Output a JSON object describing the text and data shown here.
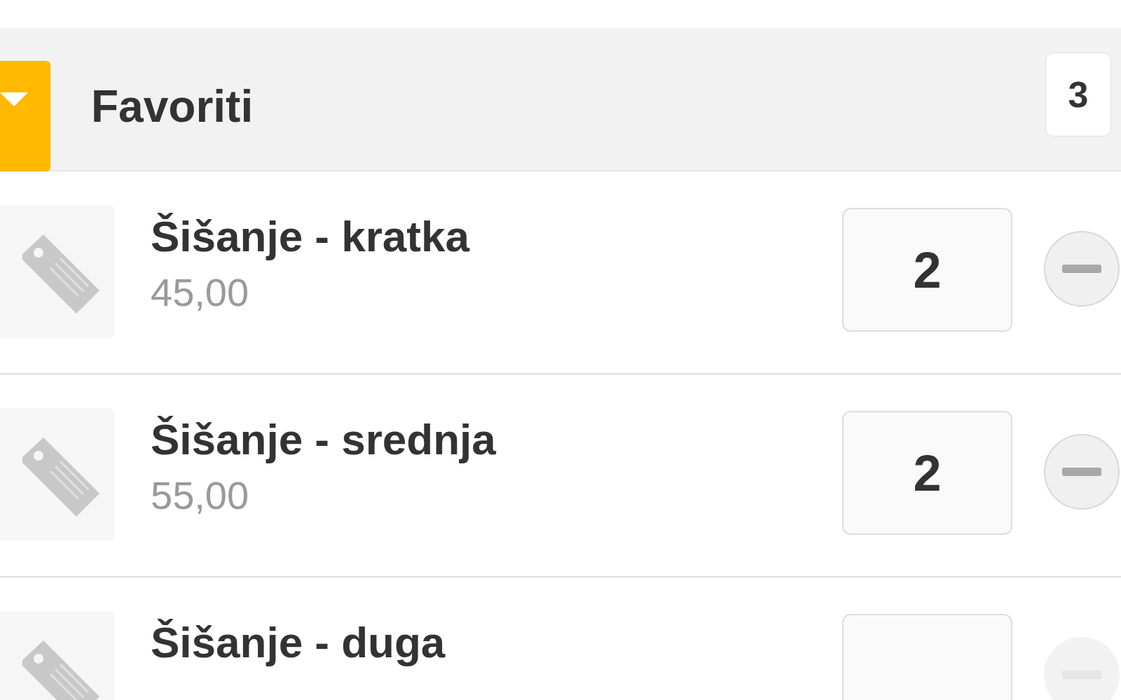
{
  "group": {
    "title": "Favoriti",
    "expanded": true,
    "count": "3"
  },
  "items": [
    {
      "name": "Šišanje - kratka",
      "price": "45,00",
      "quantity": "2",
      "minus_disabled": false
    },
    {
      "name": "Šišanje - srednja",
      "price": "55,00",
      "quantity": "2",
      "minus_disabled": false
    },
    {
      "name": "Šišanje - duga",
      "minus_disabled": true
    }
  ]
}
